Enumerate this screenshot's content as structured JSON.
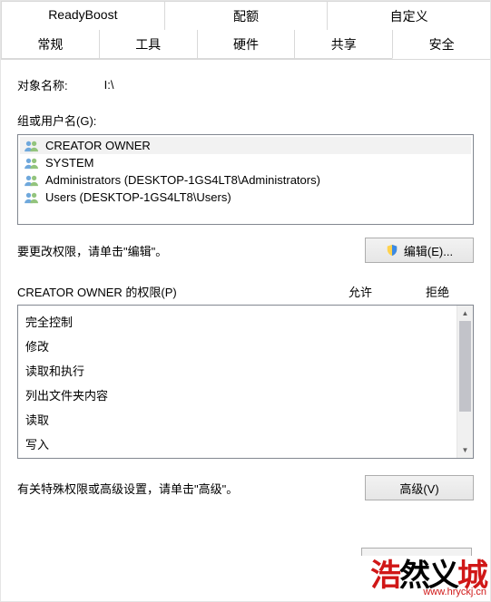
{
  "tabs": {
    "row1": [
      "ReadyBoost",
      "配额",
      "自定义"
    ],
    "row2": [
      "常规",
      "工具",
      "硬件",
      "共享",
      "安全"
    ],
    "active": "安全"
  },
  "object": {
    "label": "对象名称:",
    "value": "I:\\"
  },
  "groups": {
    "label": "组或用户名(G):",
    "items": [
      "CREATOR OWNER",
      "SYSTEM",
      "Administrators (DESKTOP-1GS4LT8\\Administrators)",
      "Users (DESKTOP-1GS4LT8\\Users)"
    ],
    "selected_index": 0
  },
  "edit": {
    "hint": "要更改权限，请单击\"编辑\"。",
    "button": "编辑(E)..."
  },
  "permissions": {
    "title": "CREATOR OWNER 的权限(P)",
    "allow": "允许",
    "deny": "拒绝",
    "items": [
      "完全控制",
      "修改",
      "读取和执行",
      "列出文件夹内容",
      "读取",
      "写入"
    ]
  },
  "advanced": {
    "hint": "有关特殊权限或高级设置，请单击\"高级\"。",
    "button": "高级(V)"
  },
  "watermark": {
    "text_part1": "浩",
    "text_part2": "然义",
    "text_part3": "城",
    "url": "www.hryckj.cn"
  }
}
